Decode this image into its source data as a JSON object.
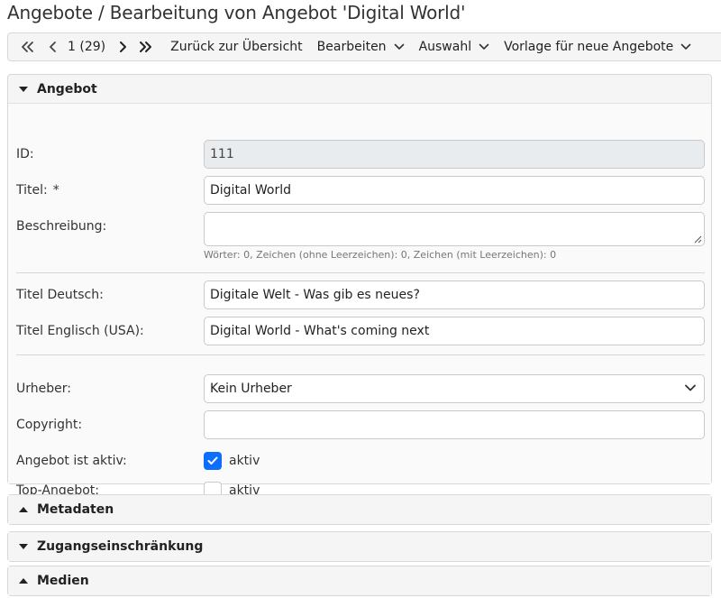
{
  "page": {
    "title": "Angebote / Bearbeitung von Angebot 'Digital World'"
  },
  "toolbar": {
    "record_position": "1 (29)",
    "back_to_overview": "Zurück zur Übersicht",
    "edit_menu": "Bearbeiten",
    "selection_menu": "Auswahl",
    "template_menu": "Vorlage für neue Angebote",
    "icons": [
      "first-record-icon",
      "previous-record-icon",
      "next-record-icon",
      "last-record-icon",
      "chevron-down-icon"
    ]
  },
  "sections": {
    "angebot": {
      "title": "Angebot",
      "state": "expanded",
      "fields": {
        "id": {
          "label": "ID:",
          "value": "111"
        },
        "titel": {
          "label": "Titel:",
          "required_marker": "*",
          "value": "Digital World"
        },
        "beschreibung": {
          "label": "Beschreibung:",
          "value": "",
          "hint": "Wörter: 0, Zeichen (ohne Leerzeichen): 0, Zeichen (mit Leerzeichen): 0"
        },
        "titel_deutsch": {
          "label": "Titel Deutsch:",
          "value": "Digitale Welt - Was gib es neues?"
        },
        "titel_englisch": {
          "label": "Titel Englisch (USA):",
          "value": "Digital World - What's coming next"
        },
        "urheber": {
          "label": "Urheber:",
          "value": "Kein Urheber"
        },
        "copyright": {
          "label": "Copyright:",
          "value": ""
        },
        "aktiv": {
          "label": "Angebot ist aktiv:",
          "checkbox_label": "aktiv",
          "checked": true
        },
        "top_angebot": {
          "label": "Top-Angebot:",
          "checkbox_label": "aktiv",
          "checked": false
        }
      }
    },
    "metadaten": {
      "title": "Metadaten",
      "state": "collapsed"
    },
    "zugang": {
      "title": "Zugangseinschränkung",
      "state": "expanded"
    },
    "medien": {
      "title": "Medien",
      "state": "collapsed"
    }
  },
  "colors": {
    "accent": "#0d6efd",
    "panel_bg": "#fafafa",
    "header_bg": "#f5f5f5",
    "readonly_bg": "#e9ecef"
  }
}
